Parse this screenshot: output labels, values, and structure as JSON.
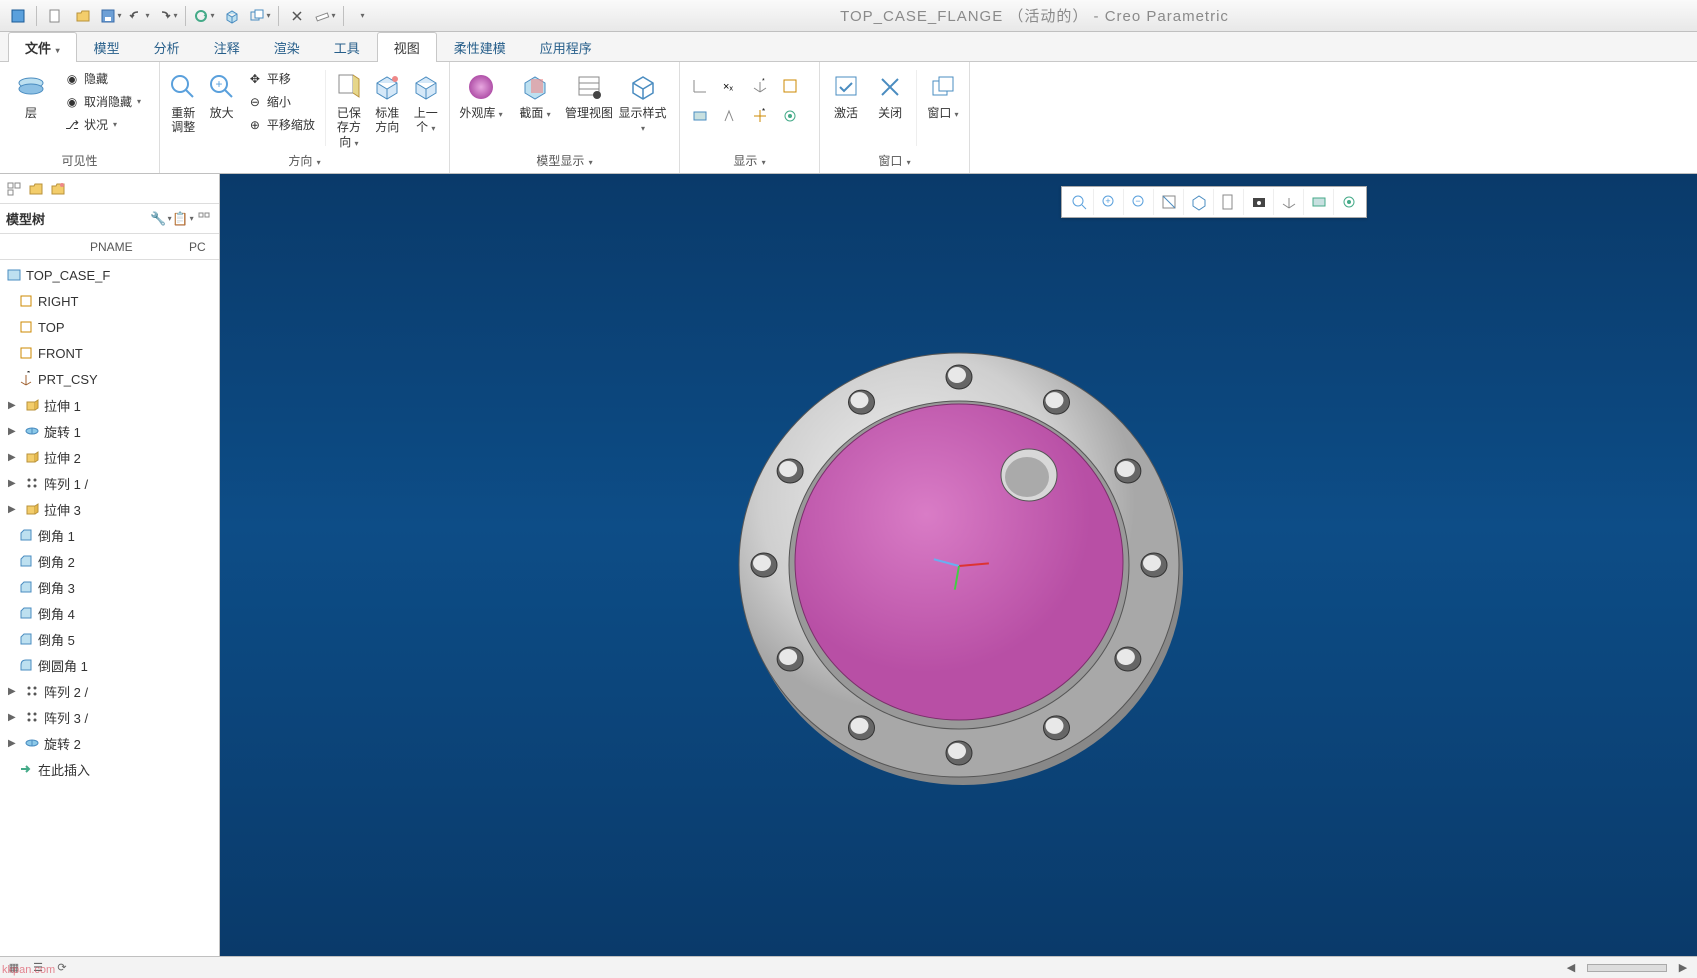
{
  "title_doc": "TOP_CASE_FLANGE （活动的）",
  "title_app": " - Creo Parametric",
  "ribbon_tabs": {
    "file": "文件",
    "model": "模型",
    "analysis": "分析",
    "annotate": "注释",
    "render": "渲染",
    "tools": "工具",
    "view": "视图",
    "flexmodel": "柔性建模",
    "apps": "应用程序"
  },
  "groups": {
    "visibility": {
      "title": "可见性",
      "layers": "层",
      "hide": "隐藏",
      "unhide": "取消隐藏",
      "status": "状况"
    },
    "orient": {
      "title": "方向",
      "refit": "重新调整",
      "zoomin": "放大",
      "pan": "平移",
      "zoomout": "缩小",
      "panzoom": "平移缩放"
    },
    "orient2": {
      "saved": "已保存方向",
      "standard": "标准方向",
      "prev": "上一个"
    },
    "modeldisp": {
      "title": "模型显示",
      "appearance": "外观库",
      "section": "截面",
      "manage": "管理视图",
      "dispstyle": "显示样式"
    },
    "show": {
      "title": "显示"
    },
    "window": {
      "title": "窗口",
      "activate": "激活",
      "close": "关闭",
      "windows": "窗口"
    }
  },
  "model_tree": {
    "title": "模型树",
    "col1": "PNAME",
    "col2": "PC",
    "root": "TOP_CASE_F",
    "items": [
      {
        "icon": "datum",
        "label": "RIGHT"
      },
      {
        "icon": "datum",
        "label": "TOP"
      },
      {
        "icon": "datum",
        "label": "FRONT"
      },
      {
        "icon": "csys",
        "label": "PRT_CSY"
      },
      {
        "icon": "extrude",
        "label": "拉伸 1",
        "exp": true
      },
      {
        "icon": "revolve",
        "label": "旋转 1",
        "exp": true
      },
      {
        "icon": "extrude",
        "label": "拉伸 2",
        "exp": true
      },
      {
        "icon": "pattern",
        "label": "阵列 1 /",
        "exp": true
      },
      {
        "icon": "extrude",
        "label": "拉伸 3",
        "exp": true
      },
      {
        "icon": "chamfer",
        "label": "倒角 1"
      },
      {
        "icon": "chamfer",
        "label": "倒角 2"
      },
      {
        "icon": "chamfer",
        "label": "倒角 3"
      },
      {
        "icon": "chamfer",
        "label": "倒角 4"
      },
      {
        "icon": "chamfer",
        "label": "倒角 5"
      },
      {
        "icon": "round",
        "label": "倒圆角 1"
      },
      {
        "icon": "pattern",
        "label": "阵列 2 /",
        "exp": true
      },
      {
        "icon": "pattern",
        "label": "阵列 3 /",
        "exp": true
      },
      {
        "icon": "revolve",
        "label": "旋转 2",
        "exp": true
      },
      {
        "icon": "insert",
        "label": "在此插入"
      }
    ]
  },
  "watermark": "kkpan.com"
}
